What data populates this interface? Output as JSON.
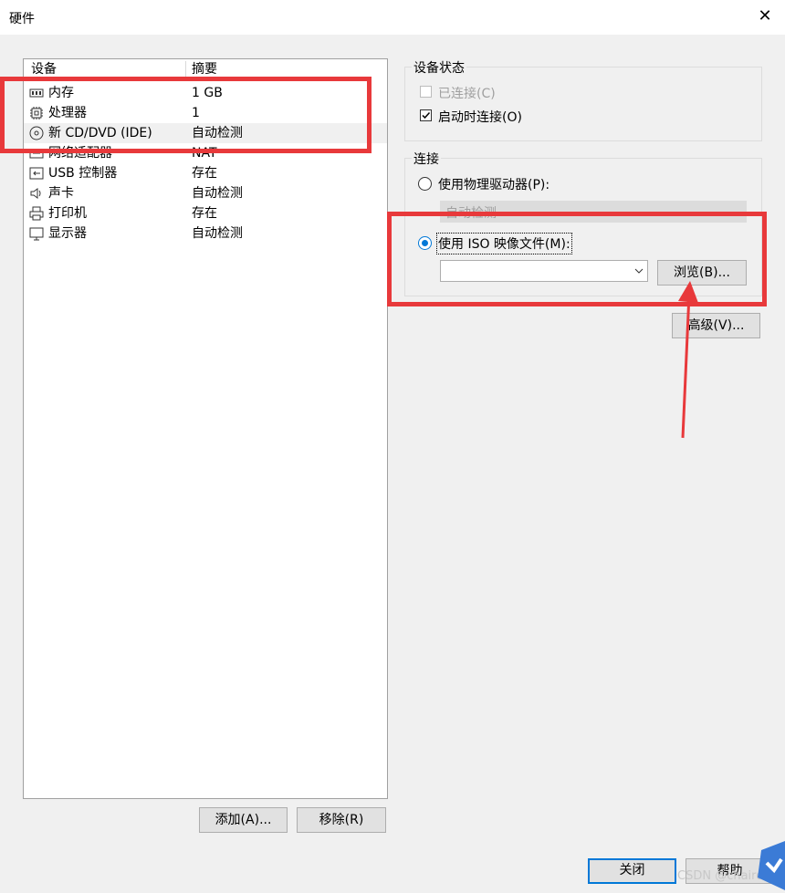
{
  "window": {
    "title": "硬件"
  },
  "list": {
    "col_device": "设备",
    "col_summary": "摘要",
    "rows": [
      {
        "name": "内存",
        "summary": "1 GB",
        "icon": "memory-icon"
      },
      {
        "name": "处理器",
        "summary": "1",
        "icon": "processor-icon"
      },
      {
        "name": "新 CD/DVD (IDE)",
        "summary": "自动检测",
        "icon": "cd-dvd-icon"
      },
      {
        "name": "网络适配器",
        "summary": "NAT",
        "icon": "network-adapter-icon"
      },
      {
        "name": "USB 控制器",
        "summary": "存在",
        "icon": "usb-icon"
      },
      {
        "name": "声卡",
        "summary": "自动检测",
        "icon": "speaker-icon"
      },
      {
        "name": "打印机",
        "summary": "存在",
        "icon": "printer-icon"
      },
      {
        "name": "显示器",
        "summary": "自动检测",
        "icon": "monitor-icon"
      }
    ]
  },
  "buttons": {
    "add": "添加(A)...",
    "remove": "移除(R)",
    "close": "关闭",
    "help": "帮助",
    "browse": "浏览(B)...",
    "advanced": "高级(V)..."
  },
  "device_status": {
    "label": "设备状态",
    "connected": "已连接(C)",
    "connect_on_start": "启动时连接(O)"
  },
  "connection": {
    "label": "连接",
    "physical": "使用物理驱动器(P):",
    "physical_value": "自动检测",
    "iso": "使用 ISO 映像文件(M):",
    "iso_value": ""
  },
  "watermark": "CSDN @chairon",
  "colors": {
    "highlight": "#e8393b",
    "accent": "#0078d7"
  }
}
